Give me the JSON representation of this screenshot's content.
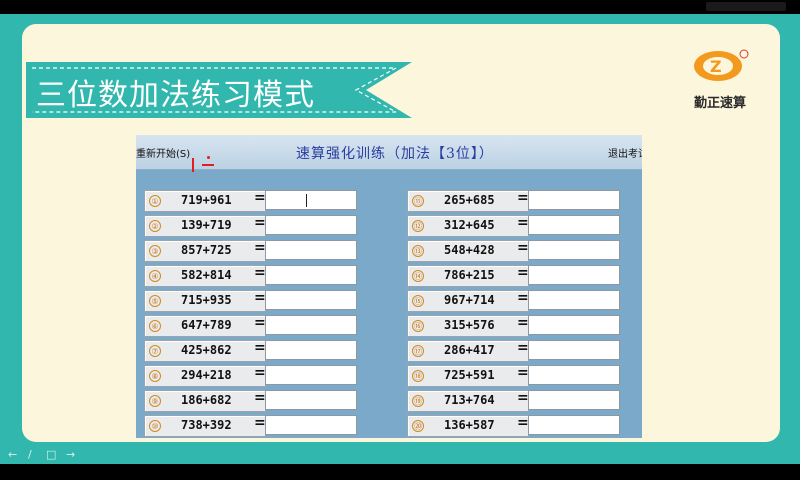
{
  "slide": {
    "title": "三位数加法练习模式",
    "logo_text": "勤正速算",
    "colors": {
      "frame": "#31b7ad",
      "slide": "#fbf6dc",
      "banner": "#31b7ad"
    }
  },
  "app": {
    "restart_label": "重新开始(S)",
    "title": "速算强化训练（加法【3位】）",
    "exit_label": "退出考试"
  },
  "problems": {
    "left": [
      {
        "n": "①",
        "expr": "719+961"
      },
      {
        "n": "②",
        "expr": "139+719"
      },
      {
        "n": "③",
        "expr": "857+725"
      },
      {
        "n": "④",
        "expr": "582+814"
      },
      {
        "n": "⑤",
        "expr": "715+935"
      },
      {
        "n": "⑥",
        "expr": "647+789"
      },
      {
        "n": "⑦",
        "expr": "425+862"
      },
      {
        "n": "⑧",
        "expr": "294+218"
      },
      {
        "n": "⑨",
        "expr": "186+682"
      },
      {
        "n": "⑩",
        "expr": "738+392"
      }
    ],
    "right": [
      {
        "n": "⑪",
        "expr": "265+685"
      },
      {
        "n": "⑫",
        "expr": "312+645"
      },
      {
        "n": "⑬",
        "expr": "548+428"
      },
      {
        "n": "⑭",
        "expr": "786+215"
      },
      {
        "n": "⑮",
        "expr": "967+714"
      },
      {
        "n": "⑯",
        "expr": "315+576"
      },
      {
        "n": "⑰",
        "expr": "286+417"
      },
      {
        "n": "⑱",
        "expr": "725+591"
      },
      {
        "n": "⑲",
        "expr": "713+764"
      },
      {
        "n": "⑳",
        "expr": "136+587"
      }
    ],
    "equals": "="
  },
  "player_controls": [
    "←",
    "/",
    "□",
    "→"
  ]
}
